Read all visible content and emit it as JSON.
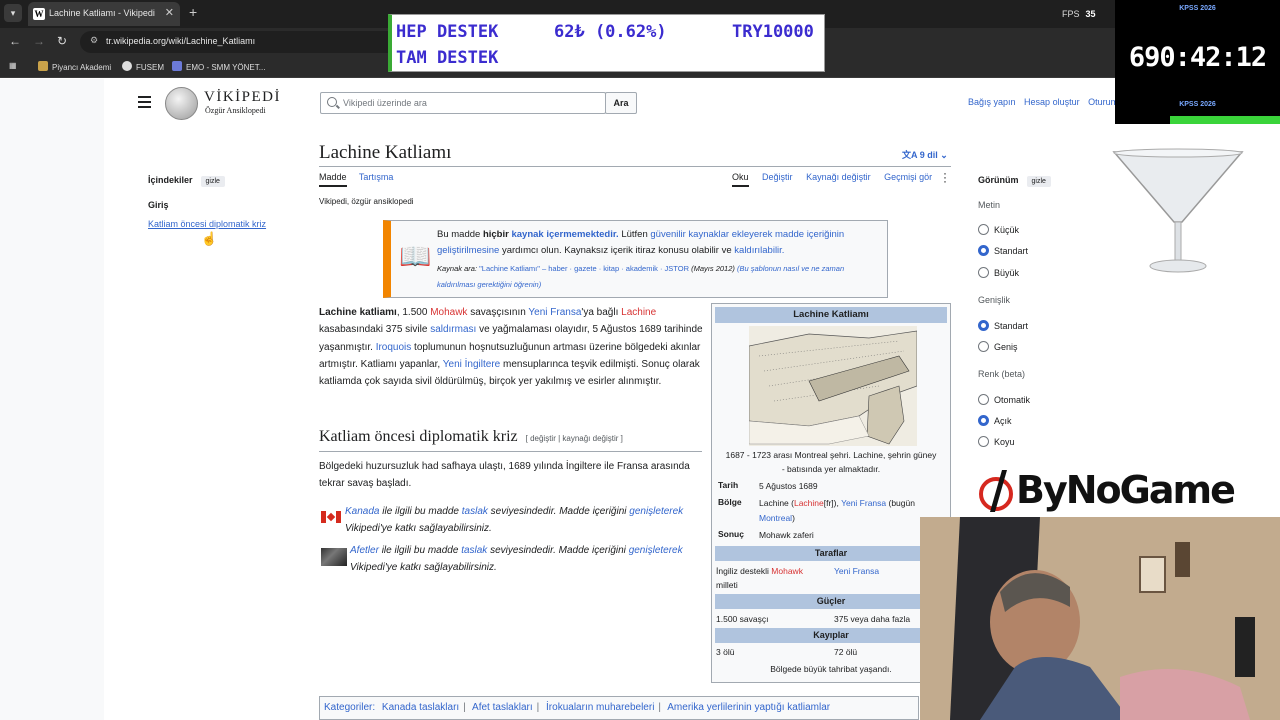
{
  "browser": {
    "tab_title": "Lachine Katliamı - Vikipedi",
    "url": "tr.wikipedia.org/wiki/Lachine_Katliamı",
    "fps_label": "FPS",
    "fps_value": "35",
    "bookmarks": [
      "Piyancı Akademi",
      "FUSEM",
      "EMO - SMM YÖNET..."
    ]
  },
  "wiki": {
    "logo_title": "VİKİPEDİ",
    "logo_subtitle": "Özgür Ansiklopedi",
    "search_placeholder": "Vikipedi üzerinde ara",
    "search_button": "Ara",
    "top_links": [
      "Bağış yapın",
      "Hesap oluştur",
      "Oturum"
    ]
  },
  "toc": {
    "heading": "İçindekiler",
    "hide": "gizle",
    "items": [
      "Giriş",
      "Katliam öncesi diplomatik kriz"
    ]
  },
  "article": {
    "title": "Lachine Katliamı",
    "langs": "9 dil",
    "tabs_left": [
      "Madde",
      "Tartışma"
    ],
    "tabs_right": [
      "Oku",
      "Değiştir",
      "Kaynağı değiştir",
      "Geçmişi gör"
    ],
    "tagline": "Vikipedi, özgür ansiklopedi",
    "notice": {
      "p1": "Bu madde",
      "p2": "hiçbir",
      "p3": "kaynak içermemektedir.",
      "p4": "Lütfen",
      "p5": "güvenilir kaynaklar ekleyerek madde içeriğinin geliştirilmesine",
      "p6": "yardımcı olun. Kaynaksız içerik itiraz konusu olabilir ve",
      "p7": "kaldırılabilir.",
      "find_label": "Kaynak ara:",
      "find_query": "\"Lachine Katliamı\"",
      "find_links": "– haber · gazete · kitap · akademik · JSTOR",
      "date": "(Mayıs 2012)",
      "howto": "(Bu şablonun nasıl ve ne zaman kaldırılması gerektiğini öğrenin)"
    },
    "para1": {
      "bold": "Lachine katliamı",
      "t1": ", 1.500",
      "l1": "Mohawk",
      "t2": "savaşçısının",
      "l2": "Yeni Fransa",
      "t3": "'ya bağlı",
      "l3": "Lachine",
      "t4": "kasabasındaki 375 sivile",
      "l4": "saldırması",
      "t5": "ve yağmalaması olayıdır, 5 Ağustos 1689 tarihinde yaşanmıştır.",
      "l5": "Iroquois",
      "t6": "toplumunun hoşnutsuzluğunun artması üzerine bölgedeki akınlar artmıştır. Katliamı yapanlar,",
      "l6": "Yeni İngiltere",
      "t7": "mensuplarınca teşvik edilmişti. Sonuç olarak katliamda çok sayıda sivil öldürülmüş, birçok yer yakılmış ve esirler alınmıştır."
    },
    "h2": "Katliam öncesi diplomatik kriz",
    "h2_edit": "[ değiştir | kaynağı değiştir ]",
    "para2": "Bölgedeki huzursuzluk had safhaya ulaştı, 1689 yılında İngiltere ile Fransa arasında tekrar savaş başladı.",
    "stub1": {
      "l1": "Kanada",
      "t1": "ile ilgili bu madde",
      "l2": "taslak",
      "t2": "seviyesindedir. Madde içeriğini",
      "l3": "genişleterek",
      "t3": "Vikipedi'ye katkı sağlayabilirsiniz."
    },
    "stub2": {
      "l1": "Afetler",
      "t1": "ile ilgili bu madde",
      "l2": "taslak",
      "t2": "seviyesindedir. Madde içeriğini",
      "l3": "genişleterek",
      "t3": "Vikipedi'ye katkı sağlayabilirsiniz."
    },
    "categories_label": "Kategoriler:",
    "categories": [
      "Kanada taslakları",
      "Afet taslakları",
      "İrokuaların muharebeleri",
      "Amerika yerlilerinin yaptığı katliamlar"
    ]
  },
  "infobox": {
    "title": "Lachine Katliamı",
    "caption": "1687 - 1723 arası Montreal şehri. Lachine, şehrin güney - batısında yer almaktadır.",
    "date_label": "Tarih",
    "date": "5 Ağustos 1689",
    "region_label": "Bölge",
    "region_a": "Lachine (",
    "region_b": "Lachine",
    "region_c": "[fr]), ",
    "region_d": "Yeni Fransa",
    "region_e": " (bugün ",
    "region_f": "Montreal",
    "region_g": ")",
    "result_label": "Sonuç",
    "result": "Mohawk zaferi",
    "parties_label": "Taraflar",
    "party1_a": "İngiliz destekli",
    "party1_b": "Mohawk",
    "party1_c": "milleti",
    "party2": "Yeni Fransa",
    "forces_label": "Güçler",
    "forces1": "1.500 savaşçı",
    "forces2": "375 veya daha fazla",
    "losses_label": "Kayıplar",
    "loss1": "3 ölü",
    "loss2": "72 ölü",
    "footer": "Bölgede büyük tahribat yaşandı."
  },
  "appearance": {
    "heading": "Görünüm",
    "hide": "gizle",
    "text_label": "Metin",
    "text_options": [
      "Küçük",
      "Standart",
      "Büyük"
    ],
    "width_label": "Genişlik",
    "width_options": [
      "Standart",
      "Geniş"
    ],
    "color_label": "Renk (beta)",
    "color_options": [
      "Otomatik",
      "Açık",
      "Koyu"
    ]
  },
  "overlay": {
    "ticker_l1": "HEP DESTEK",
    "ticker_amount": "62₺ (0.62%)",
    "ticker_goal": "TRY10000",
    "ticker_l2": "TAM DESTEK",
    "timer_label_top": "KPSS 2026",
    "timer_value": "690:42:12",
    "timer_label_bottom": "KPSS 2026",
    "sponsor": "ByNoGame"
  }
}
